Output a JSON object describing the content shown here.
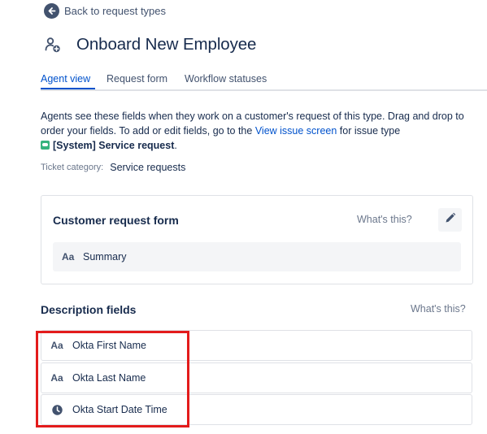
{
  "back_link": {
    "label": "Back to request types"
  },
  "header": {
    "title": "Onboard New Employee",
    "icon": "person-add-icon"
  },
  "tabs": [
    {
      "label": "Agent view",
      "active": true
    },
    {
      "label": "Request form",
      "active": false
    },
    {
      "label": "Workflow statuses",
      "active": false
    }
  ],
  "description": {
    "part1": "Agents see these fields when they work on a customer's request of this type. Drag and drop to order your fields. To add or edit fields, go to the ",
    "link": "View issue screen",
    "part2": " for issue type ",
    "issue_type": "[System] Service request",
    "end": "."
  },
  "ticket_category": {
    "label": "Ticket category:",
    "value": "Service requests"
  },
  "customer_request_form": {
    "title": "Customer request form",
    "whats_this": "What's this?",
    "fields": [
      {
        "icon": "Aa",
        "label": "Summary"
      }
    ]
  },
  "description_fields": {
    "title": "Description fields",
    "whats_this": "What's this?",
    "fields": [
      {
        "icon": "Aa",
        "label": "Okta First Name"
      },
      {
        "icon": "Aa",
        "label": "Okta Last Name"
      },
      {
        "icon": "clock-icon",
        "label": "Okta Start Date Time"
      }
    ]
  },
  "colors": {
    "accent": "#0052cc",
    "text": "#172b4d",
    "muted": "#6b778c",
    "highlight": "#e31b1b"
  }
}
